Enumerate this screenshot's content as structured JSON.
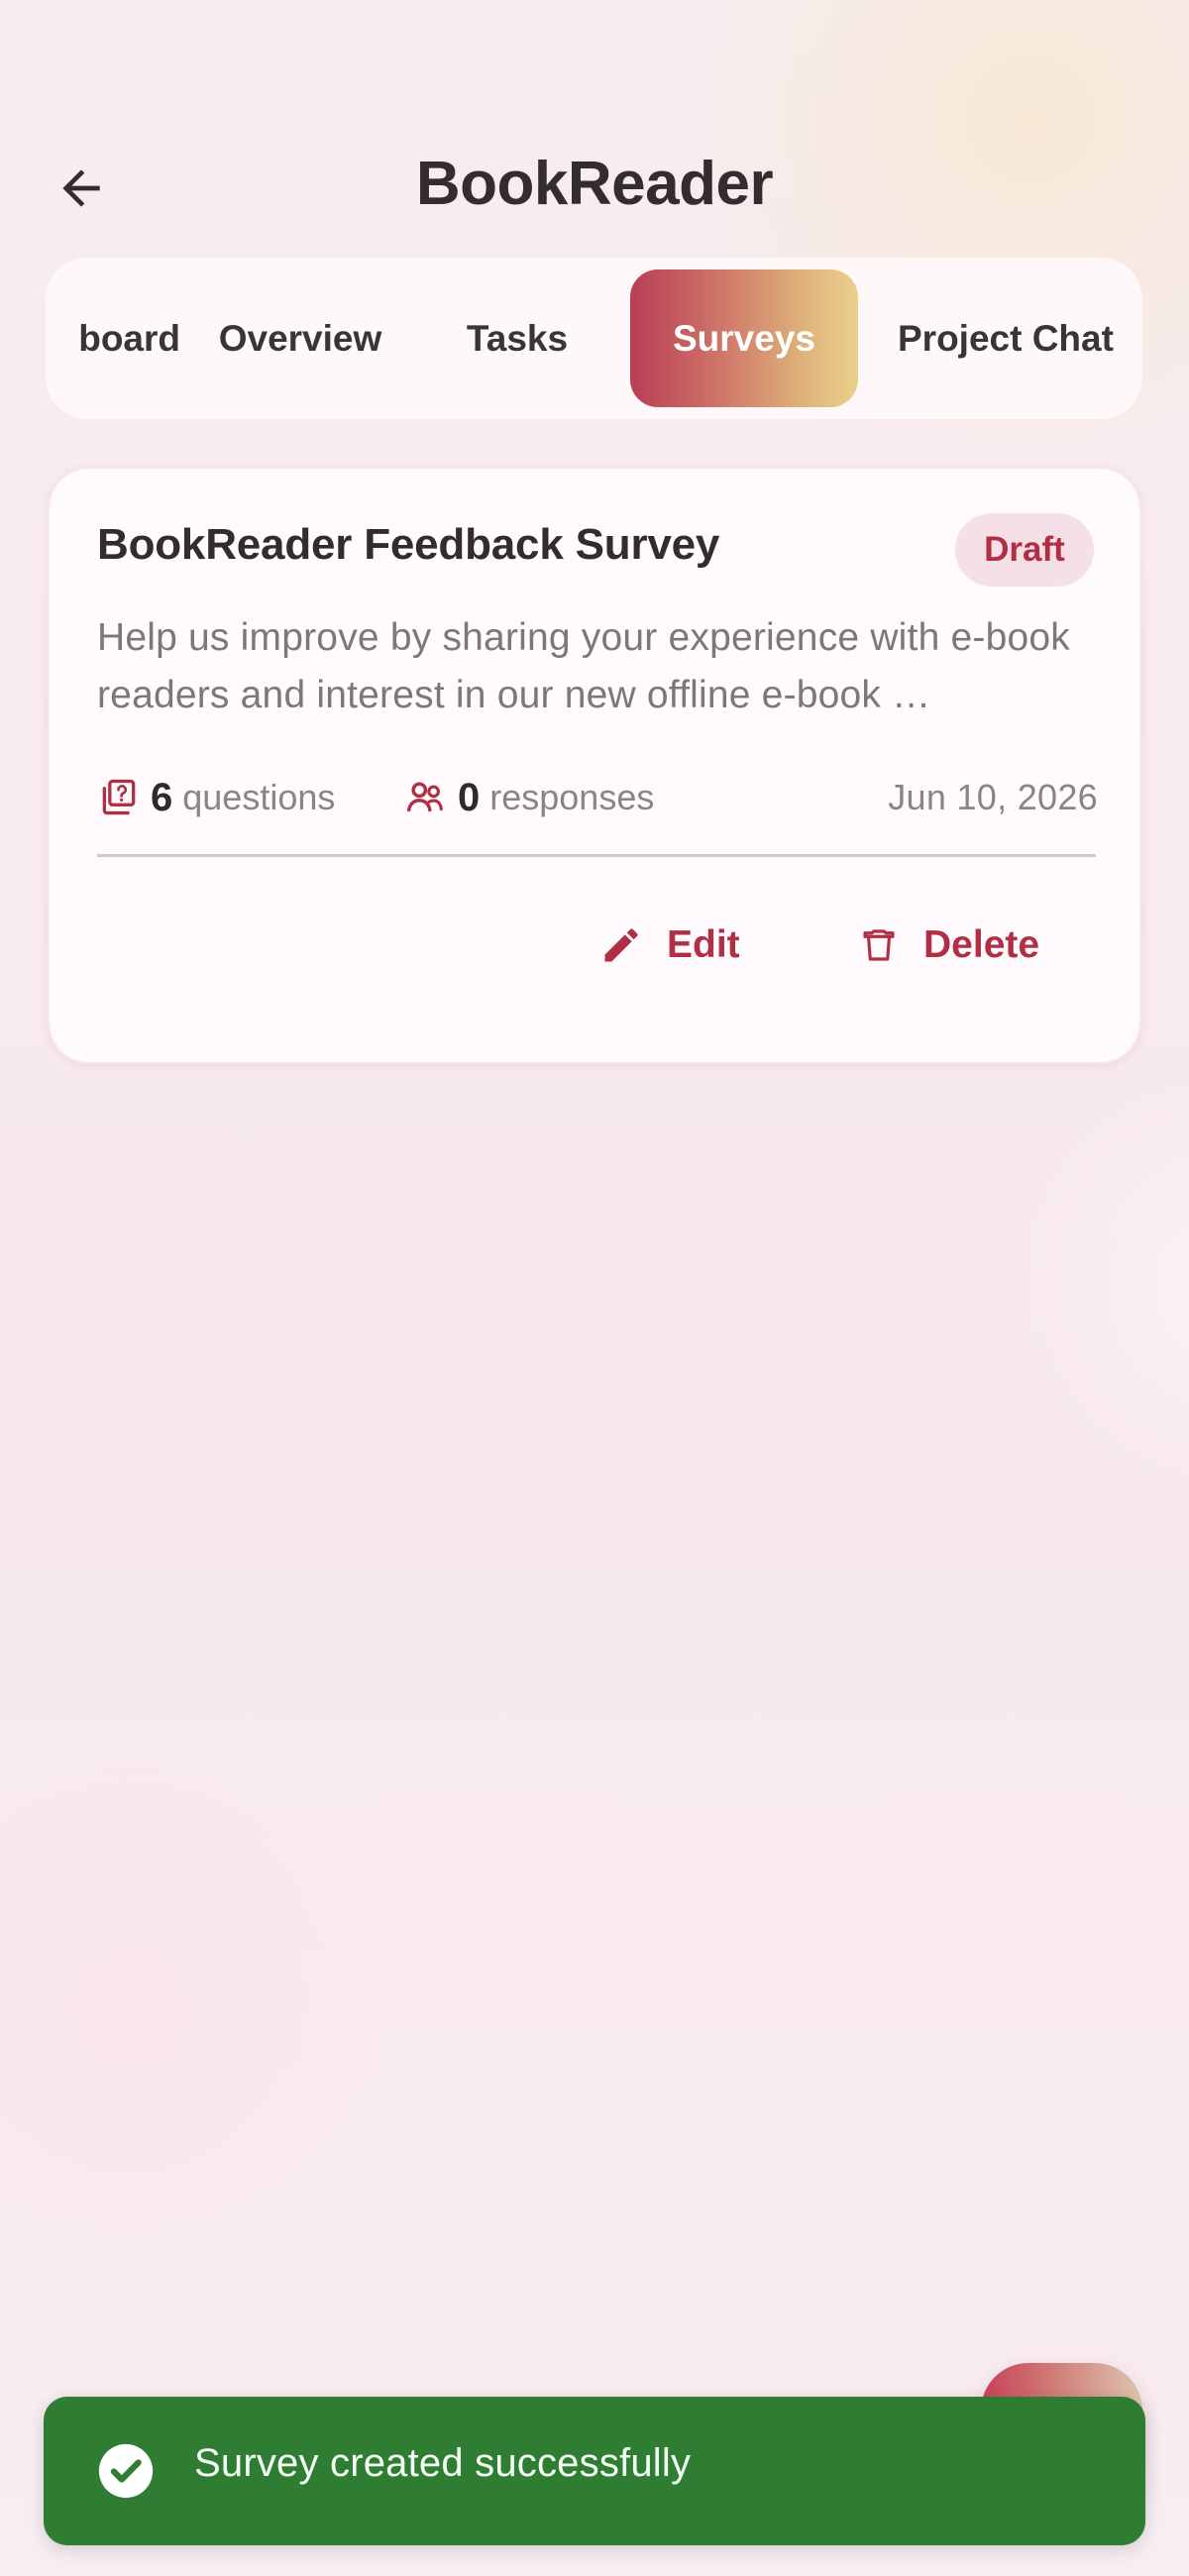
{
  "app": {
    "title": "BookReader"
  },
  "icons": {
    "back": "arrow-left-icon",
    "questions": "quiz-icon",
    "responses": "group-icon",
    "edit": "pencil-icon",
    "delete": "trash-icon",
    "success": "check-circle-icon"
  },
  "tabs": [
    {
      "label": "board"
    },
    {
      "label": "Overview"
    },
    {
      "label": "Tasks"
    },
    {
      "label": "Surveys",
      "active": true
    },
    {
      "label": "Project Chat"
    }
  ],
  "survey_card": {
    "title": "BookReader Feedback Survey",
    "status": "Draft",
    "description": "Help us improve by sharing your experience with e-book readers and interest in our new offline e-book …",
    "questions": {
      "count": "6",
      "label": "questions"
    },
    "responses": {
      "count": "0",
      "label": "responses"
    },
    "date": "Jun 10, 2026",
    "actions": {
      "edit": "Edit",
      "delete": "Delete"
    }
  },
  "snackbar": {
    "message": "Survey created successfully"
  },
  "colors": {
    "accent": "#B12F44",
    "accent_gradient_end": "#ECCF8C",
    "background": "#F8EAF0",
    "card": "#FFFBFD",
    "success": "#2E7D32"
  }
}
